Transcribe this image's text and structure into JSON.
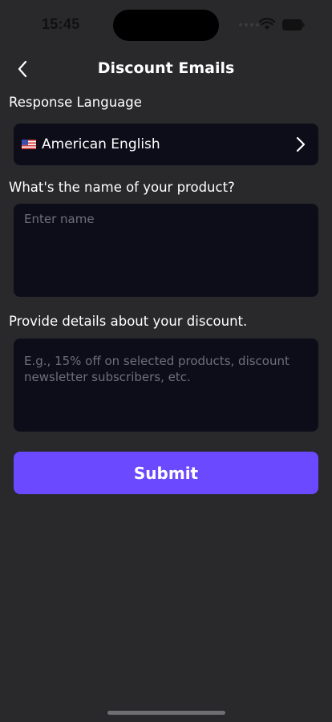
{
  "status_bar": {
    "time": "15:45"
  },
  "header": {
    "title": "Discount Emails",
    "back_icon": "chevron-left-icon"
  },
  "form": {
    "language": {
      "label": "Response Language",
      "flag_icon": "us-flag-icon",
      "value": "American English",
      "chevron_icon": "chevron-right-icon"
    },
    "product_name": {
      "label": "What's the name of your product?",
      "placeholder": "Enter name",
      "value": ""
    },
    "discount_details": {
      "label": "Provide details about your discount.",
      "placeholder": "E.g., 15% off on selected products, discount newsletter subscribers, etc.",
      "value": ""
    },
    "submit_label": "Submit"
  },
  "colors": {
    "background": "#29282b",
    "field_background": "#0c0d19",
    "accent": "#6b49ff",
    "placeholder": "#6e6f79"
  }
}
